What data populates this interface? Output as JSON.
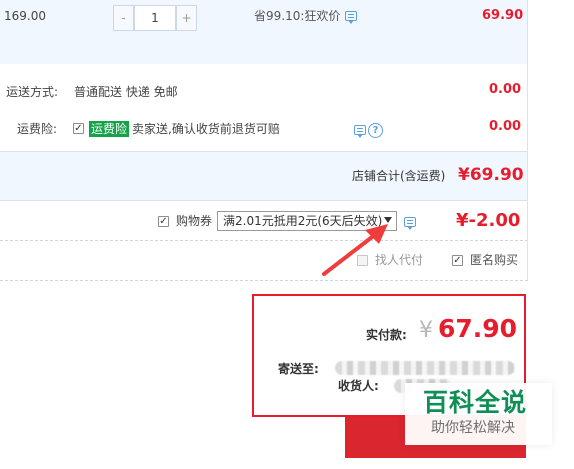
{
  "item": {
    "unit_price": "169.00",
    "quantity": "1",
    "promo": "省99.10:狂欢价",
    "subtotal": "69.90",
    "minus": "-",
    "plus": "+"
  },
  "shipping": {
    "label": "运送方式:",
    "value": "普通配送 快递 免邮",
    "price": "0.00"
  },
  "insurance": {
    "label": "运费险:",
    "badge": "运费险",
    "value": "卖家送,确认收货前退货可赔",
    "price": "0.00"
  },
  "store_total": {
    "label": "店铺合计(含运费)",
    "value": "¥69.90"
  },
  "voucher": {
    "label": "购物券",
    "selected": "满2.01元抵用2元(6天后失效)",
    "amount": "¥-2.00"
  },
  "options": {
    "proxy_pay": "找人代付",
    "anonymous": "匿名购买"
  },
  "payment": {
    "label": "实付款:",
    "currency": "¥",
    "amount": "67.90",
    "ship_to_label": "寄送至:",
    "receiver_label": "收货人:"
  },
  "watermark": {
    "title": "百科全说",
    "subtitle": "助你轻松解决"
  },
  "colors": {
    "accent_red": "#e71d2d",
    "price_red": "#d9262f",
    "link_blue": "#5aa0dd",
    "watermark_green": "#0f8f56"
  },
  "icons": {
    "message": "message-icon",
    "help": "question-icon",
    "arrow": "red-arrow"
  }
}
